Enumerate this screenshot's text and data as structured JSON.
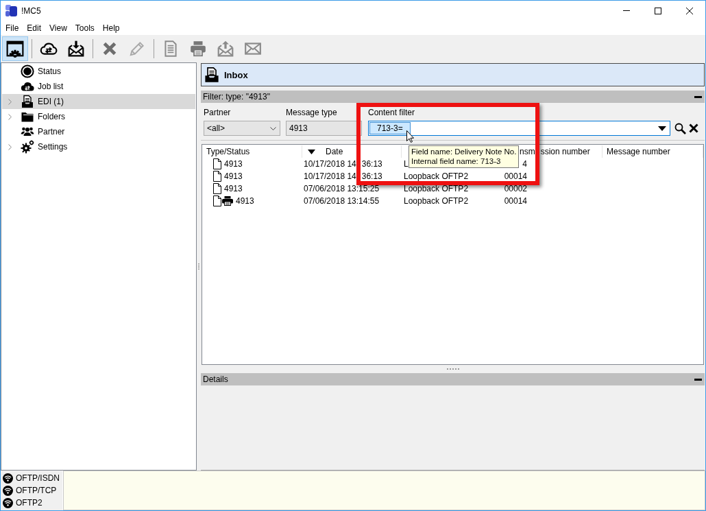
{
  "window": {
    "title": "!MC5"
  },
  "menu": [
    {
      "label": "File"
    },
    {
      "label": "Edit"
    },
    {
      "label": "View"
    },
    {
      "label": "Tools"
    },
    {
      "label": "Help"
    }
  ],
  "toolbar": [
    {
      "kind": "button",
      "selected": true,
      "disabled": false
    },
    {
      "kind": "separator"
    },
    {
      "kind": "button",
      "selected": false,
      "disabled": false
    },
    {
      "kind": "button",
      "selected": false,
      "disabled": false
    },
    {
      "kind": "separator"
    },
    {
      "kind": "button",
      "selected": false,
      "disabled": true
    },
    {
      "kind": "button",
      "selected": false,
      "disabled": true
    },
    {
      "kind": "separator"
    },
    {
      "kind": "button",
      "selected": false,
      "disabled": true
    },
    {
      "kind": "button",
      "selected": false,
      "disabled": true
    },
    {
      "kind": "button",
      "selected": false,
      "disabled": true
    },
    {
      "kind": "button",
      "selected": false,
      "disabled": true
    }
  ],
  "sidebar": {
    "items": [
      {
        "label": "Status",
        "expandable": false,
        "selected": false
      },
      {
        "label": "Job list",
        "expandable": false,
        "selected": false
      },
      {
        "label": "EDI (1)",
        "expandable": true,
        "selected": true
      },
      {
        "label": "Folders",
        "expandable": true,
        "selected": false
      },
      {
        "label": "Partner",
        "expandable": false,
        "selected": false
      },
      {
        "label": "Settings",
        "expandable": true,
        "selected": false
      }
    ]
  },
  "inbox": {
    "title": "Inbox"
  },
  "filter_bar": {
    "summary": "Filter: type: \"4913\""
  },
  "filters": {
    "partner": {
      "label": "Partner",
      "value": "<all>"
    },
    "message_type": {
      "label": "Message type",
      "value": "4913"
    },
    "content_filter": {
      "label": "Content filter",
      "token": "713-3="
    }
  },
  "table": {
    "columns": [
      {
        "kind": "text",
        "label": [
          "Type/Status"
        ]
      },
      {
        "kind": "text",
        "label": [
          "Date"
        ],
        "sort_descending": true
      },
      {
        "kind": "covered"
      },
      {
        "kind": "cut",
        "label": [
          "nsm",
          "ssion number"
        ]
      },
      {
        "kind": "text",
        "label": [
          "Message number"
        ]
      }
    ],
    "rows": [
      {
        "printed": false,
        "type": "4913",
        "date": [
          "10/17/2018 14",
          "36:13"
        ],
        "column_3": "L",
        "column_4": "4"
      },
      {
        "printed": false,
        "type": "4913",
        "date": [
          "10/17/2018 14",
          "36:13"
        ],
        "column_3": "Loopback OFTP2",
        "column_4": "00014"
      },
      {
        "printed": false,
        "type": "4913",
        "date": [
          "07/06/2018 13:15:25"
        ],
        "column_3": "Loopback OFTP2",
        "column_4": "00002"
      },
      {
        "printed": true,
        "type": "4913",
        "date": [
          "07/06/2018 13:14:55"
        ],
        "column_3": "Loopback OFTP2",
        "column_4": "00014"
      }
    ]
  },
  "details": {
    "title": "Details"
  },
  "connections": [
    {
      "label": "OFTP/ISDN"
    },
    {
      "label": "OFTP/TCP"
    },
    {
      "label": "OFTP2"
    }
  ],
  "tooltip": {
    "lines": [
      "Field name: Delivery Note No.",
      "Internal field name: 713-3"
    ]
  }
}
